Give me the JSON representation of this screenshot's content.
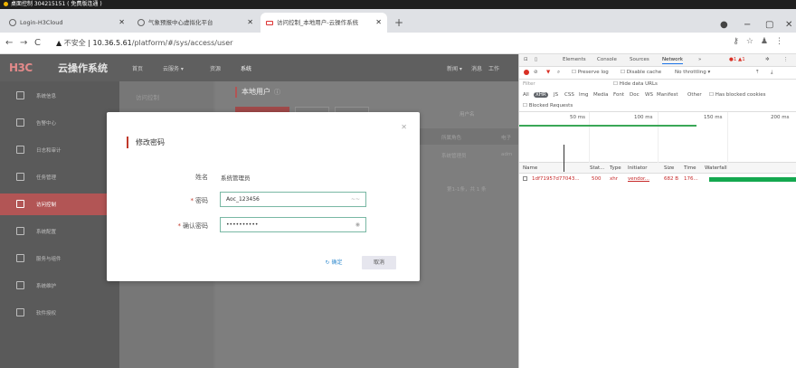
{
  "remote": {
    "title": "桌面控制 304215151 ( 免费版连通 )"
  },
  "browser": {
    "tabs": [
      {
        "label": "Login-H3Cloud"
      },
      {
        "label": "气象预报中心虚拟化平台"
      },
      {
        "label": "访问控制_本地用户-云操作系统"
      }
    ],
    "url_warning": "不安全",
    "url_host": "10.36.5.61",
    "url_path": "/platform/#/sys/access/user"
  },
  "app": {
    "brand": "H3C",
    "product": "云操作系统",
    "header_nav": [
      "首页",
      "云服务 ▾",
      "资源",
      "系统"
    ],
    "header_right": [
      "新闻 ▾",
      "消息",
      "工作"
    ],
    "sidebar": [
      {
        "label": "系统信息"
      },
      {
        "label": "告警中心"
      },
      {
        "label": "日志和审计"
      },
      {
        "label": "任务管理"
      },
      {
        "label": "访问控制"
      },
      {
        "label": "系统配置"
      },
      {
        "label": "服务与组件"
      },
      {
        "label": "系统维护"
      },
      {
        "label": "软件授权"
      }
    ],
    "sub_sidebar_title": "访问控制",
    "page_title": "本地用户",
    "filter_label": "用户名",
    "table_headers": [
      "所属角色",
      "电子"
    ],
    "table_row": [
      "系统管理员",
      "adm"
    ],
    "pager": "第1-1条，共 1 条"
  },
  "modal": {
    "title": "修改密码",
    "name_label": "姓名",
    "name_value": "系统管理员",
    "password_label": "密码",
    "password_value": "Aoc_123456",
    "confirm_label": "确认密码",
    "confirm_value": "••••••••••",
    "ok_label": "确定",
    "cancel_label": "取消"
  },
  "devtools": {
    "tabs": [
      "Elements",
      "Console",
      "Sources",
      "Network",
      "»"
    ],
    "badge": "1 ▲1",
    "toolbar": [
      "Preserve log",
      "Disable cache",
      "No throttling"
    ],
    "filter_placeholder": "Filter",
    "hide_data_urls": "Hide data URLs",
    "types": [
      "All",
      "XHR",
      "JS",
      "CSS",
      "Img",
      "Media",
      "Font",
      "Doc",
      "WS",
      "Manifest",
      "Other"
    ],
    "has_blocked": "Has blocked cookies",
    "blocked_requests": "Blocked Requests",
    "ticks": [
      "50 ms",
      "100 ms",
      "150 ms",
      "200 ms"
    ],
    "headers": [
      "Name",
      "Stat...",
      "Type",
      "Initiator",
      "Size",
      "Time",
      "Waterfall"
    ],
    "row": {
      "name": "1df71957d77043...",
      "status": "500",
      "type": "xhr",
      "initiator": "vendor...",
      "size": "682 B",
      "time": "176..."
    }
  }
}
